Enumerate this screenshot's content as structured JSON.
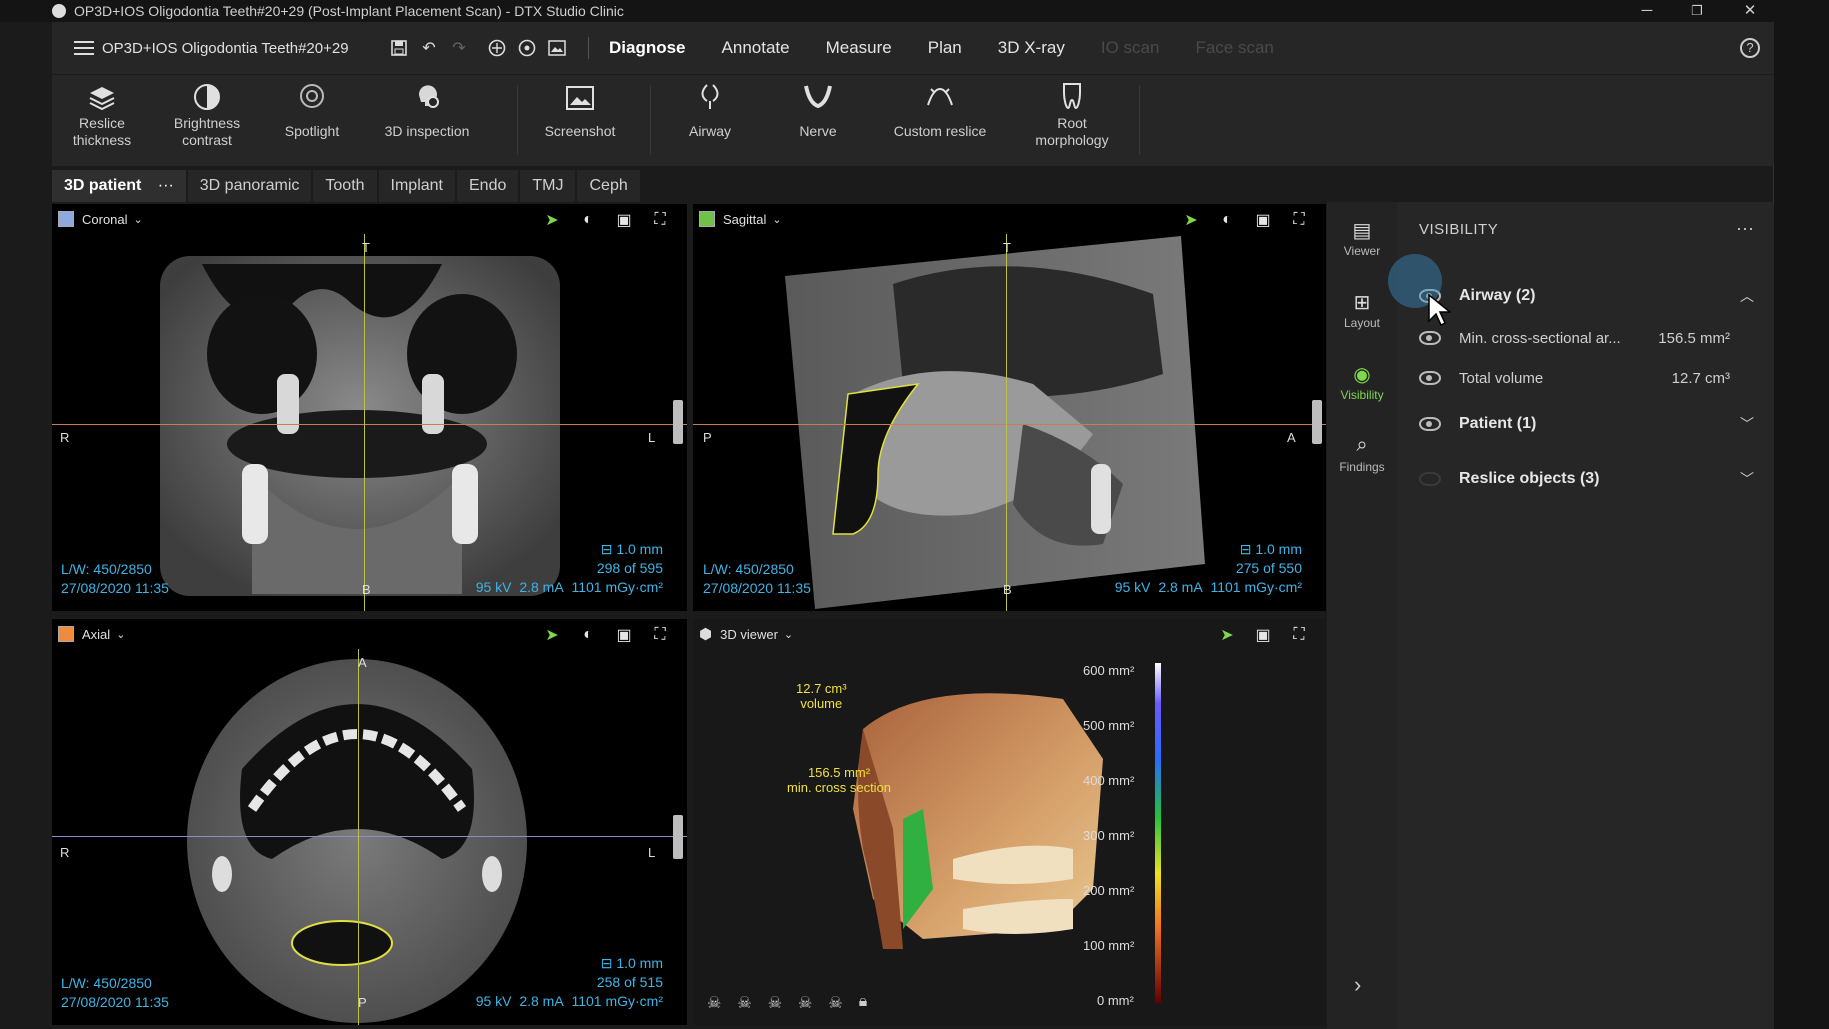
{
  "window": {
    "title": "OP3D+IOS Oligodontia Teeth#20+29 (Post-Implant Placement Scan) - DTX Studio Clinic",
    "minimize": "─",
    "restore": "❐",
    "close": "✕"
  },
  "header": {
    "project": "OP3D+IOS Oligodontia Teeth#20+29",
    "tabs": [
      {
        "label": "Diagnose",
        "state": "active"
      },
      {
        "label": "Annotate",
        "state": "normal"
      },
      {
        "label": "Measure",
        "state": "normal"
      },
      {
        "label": "Plan",
        "state": "normal"
      },
      {
        "label": "3D X-ray",
        "state": "normal"
      },
      {
        "label": "IO scan",
        "state": "disabled"
      },
      {
        "label": "Face scan",
        "state": "disabled"
      }
    ],
    "help": "?"
  },
  "toolbar": {
    "tools": [
      {
        "line1": "Reslice",
        "line2": "thickness",
        "icon": "layers-icon"
      },
      {
        "line1": "Brightness",
        "line2": "contrast",
        "icon": "contrast-icon"
      },
      {
        "line1": "Spotlight",
        "line2": "",
        "icon": "spotlight-icon"
      },
      {
        "line1": "3D inspection",
        "line2": "",
        "icon": "head-inspection-icon"
      },
      {
        "line1": "Screenshot",
        "line2": "",
        "icon": "screenshot-icon"
      },
      {
        "line1": "Airway",
        "line2": "",
        "icon": "airway-icon"
      },
      {
        "line1": "Nerve",
        "line2": "",
        "icon": "nerve-icon"
      },
      {
        "line1": "Custom reslice",
        "line2": "",
        "icon": "custom-reslice-icon"
      },
      {
        "line1": "Root",
        "line2": "morphology",
        "icon": "tooth-root-icon"
      }
    ]
  },
  "subtabs": [
    {
      "label": "3D patient",
      "active": true
    },
    {
      "label": "3D panoramic",
      "active": false
    },
    {
      "label": "Tooth",
      "active": false
    },
    {
      "label": "Implant",
      "active": false
    },
    {
      "label": "Endo",
      "active": false
    },
    {
      "label": "TMJ",
      "active": false
    },
    {
      "label": "Ceph",
      "active": false
    }
  ],
  "subtabs_more": "···",
  "viewports": {
    "coronal": {
      "title": "Coronal",
      "color": "#8fa8e0",
      "top": "T",
      "bottom": "B",
      "left": "R",
      "right": "L",
      "lw": "L/W: 450/2850",
      "date": "27/08/2020 11:35",
      "thickness": "1.0 mm",
      "slice": "298 of 595",
      "kv": "95 kV",
      "ma": "2.8 mA",
      "dose": "1101 mGy·cm²"
    },
    "sagittal": {
      "title": "Sagittal",
      "color": "#6ec24a",
      "top": "T",
      "bottom": "B",
      "left": "P",
      "right": "A",
      "lw": "L/W: 450/2850",
      "date": "27/08/2020 11:35",
      "thickness": "1.0 mm",
      "slice": "275 of 550",
      "kv": "95 kV",
      "ma": "2.8 mA",
      "dose": "1101 mGy·cm²"
    },
    "axial": {
      "title": "Axial",
      "color": "#f08a3c",
      "top": "A",
      "bottom": "P",
      "left": "R",
      "right": "L",
      "lw": "L/W: 450/2850",
      "date": "27/08/2020 11:35",
      "thickness": "1.0 mm",
      "slice": "258 of 515",
      "kv": "95 kV",
      "ma": "2.8 mA",
      "dose": "1101 mGy·cm²"
    },
    "viewer3d": {
      "title": "3D viewer",
      "volume_value": "12.7 cm³",
      "volume_label": "volume",
      "section_value": "156.5 mm²",
      "section_label": "min. cross section",
      "scale": [
        "600 mm²",
        "500 mm²",
        "400 mm²",
        "300 mm²",
        "200 mm²",
        "100 mm²",
        "0 mm²"
      ]
    }
  },
  "sidebar": {
    "items": [
      {
        "label": "Viewer",
        "icon": "viewer-icon",
        "active": false
      },
      {
        "label": "Layout",
        "icon": "layout-icon",
        "active": false
      },
      {
        "label": "Visibility",
        "icon": "eye-icon",
        "active": true
      },
      {
        "label": "Findings",
        "icon": "findings-icon",
        "active": false
      }
    ],
    "collapse": "›"
  },
  "visibility": {
    "title": "VISIBILITY",
    "more": "···",
    "groups": {
      "airway": {
        "label": "Airway (2)",
        "expanded": true
      },
      "min_cross": {
        "label": "Min. cross-sectional ar...",
        "value": "156.5 mm²"
      },
      "total_volume": {
        "label": "Total volume",
        "value": "12.7 cm³"
      },
      "patient": {
        "label": "Patient (1)",
        "expanded": false
      },
      "reslice": {
        "label": "Reslice objects (3)",
        "expanded": false
      }
    }
  }
}
